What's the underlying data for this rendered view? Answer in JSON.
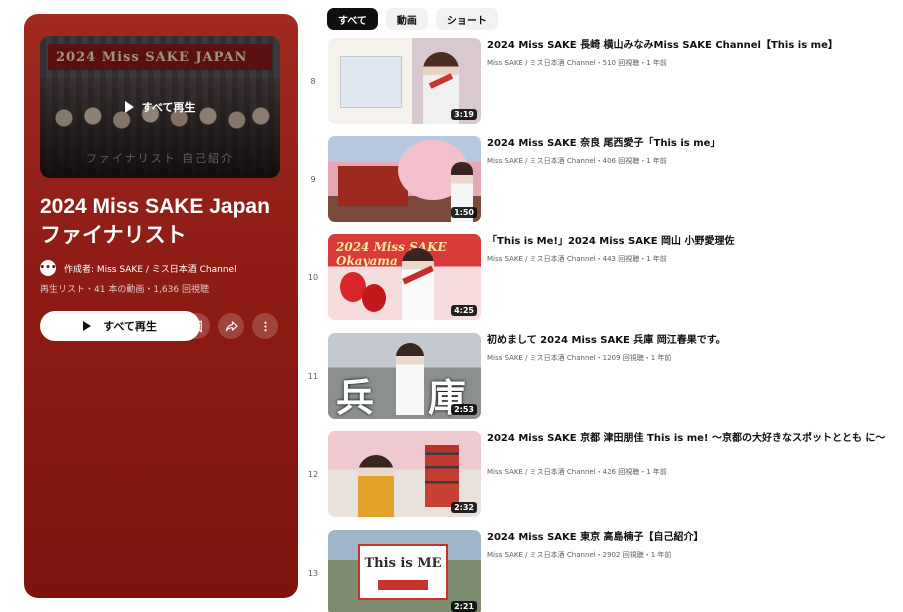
{
  "playlist": {
    "thumbnail_banner": "2024 Miss SAKE JAPAN",
    "thumbnail_play_label": "すべて再生",
    "thumbnail_subline": "ファイナリスト 自己紹介",
    "title": "2024 Miss SAKE Japan ファイナリスト",
    "owner_avatar_text": "•••",
    "owner": "作成者: Miss SAKE / ミス日本酒 Channel",
    "meta": "再生リスト・41 本の動画・1,636 回視聴",
    "play_all_label": "すべて再生",
    "icons": [
      "bookmark-icon",
      "share-icon",
      "more-vertical-icon"
    ],
    "accent_color": "#8e1c14"
  },
  "chips": [
    {
      "label": "すべて",
      "active": true
    },
    {
      "label": "動画",
      "active": false
    },
    {
      "label": "ショート",
      "active": false
    }
  ],
  "videos": [
    {
      "index": "8",
      "duration": "3:19",
      "title": "2024 Miss SAKE 長崎 横山みなみMiss SAKE Channel【This is me】",
      "meta": "Miss SAKE / ミス日本酒 Channel・510 回視聴・1 年前"
    },
    {
      "index": "9",
      "duration": "1:50",
      "title": "2024 Miss SAKE 奈良 尾西愛子「This is me」",
      "meta": "Miss SAKE / ミス日本酒 Channel・406 回視聴・1 年前"
    },
    {
      "index": "10",
      "duration": "4:25",
      "thumb_text": "2024 Miss SAKE Okayama",
      "title": "「This is Me!」2024 Miss SAKE 岡山 小野愛理佐",
      "meta": "Miss SAKE / ミス日本酒 Channel・443 回視聴・1 年前"
    },
    {
      "index": "11",
      "duration": "2:53",
      "thumb_text_1": "兵",
      "thumb_text_2": "庫",
      "title": "初めまして 2024 Miss SAKE 兵庫 岡江春果です。",
      "meta": "Miss SAKE / ミス日本酒 Channel・1209 回視聴・1 年前"
    },
    {
      "index": "12",
      "duration": "2:32",
      "title": "2024 Miss SAKE 京都 津田朋佳 This is me! ～京都の大好きなスポットととも に～",
      "meta": "Miss SAKE / ミス日本酒 Channel・426 回視聴・1 年前"
    },
    {
      "index": "13",
      "duration": "2:21",
      "thumb_text_1": "This is ME",
      "title": "2024 Miss SAKE 東京 高島楠子【自己紹介】",
      "meta": "Miss SAKE / ミス日本酒 Channel・2902 回視聴・1 年前"
    }
  ]
}
